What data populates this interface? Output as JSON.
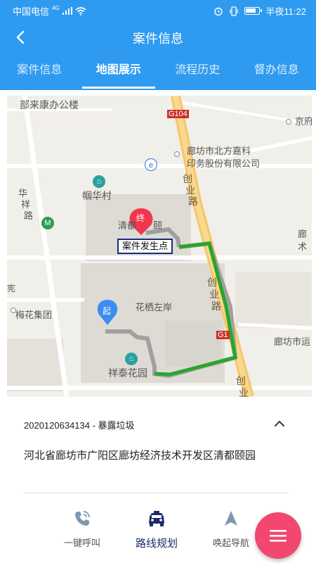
{
  "status_bar": {
    "carrier": "中国电信",
    "signal_label": "4G",
    "battery_level": 0.8,
    "time": "半夜11:22"
  },
  "app_bar": {
    "title": "案件信息",
    "back_icon": "arrow-left-icon"
  },
  "tabs": [
    {
      "label": "案件信息",
      "active": false
    },
    {
      "label": "地图展示",
      "active": true
    },
    {
      "label": "流程历史",
      "active": false
    },
    {
      "label": "督办信息",
      "active": false
    }
  ],
  "map": {
    "labels": {
      "office_building": "部来康办公楼",
      "road_g104_top": "G104",
      "jingfu": "京府",
      "company_line1": "廊坊市北方嘉科",
      "company_line2": "印务股份有限公司",
      "chuangye_road_1": "创",
      "chuangye_road_2": "业",
      "chuangye_road_3": "路",
      "huaxiang_1": "华",
      "huaxiang_2": "祥",
      "huaxiang_3": "路",
      "zhouhua_village": "帼华村",
      "qingdu": "清都",
      "yi": "颐",
      "case_marker": "案件发生点",
      "huaqi": "花栖左岸",
      "meihua": "梅花集团",
      "langfang_right": "廊坊市运",
      "xiangtai": "祥泰花园",
      "road_g1_mid": "G1",
      "chuangye_bottom_1": "创",
      "chuangye_bottom_2": "业",
      "lang_1": "廊",
      "lang_2": "术",
      "chuang_mid_1": "创",
      "chuang_mid_2": "业",
      "chuang_mid_3": "路",
      "edge_left": "宪"
    },
    "markers": {
      "start": "起",
      "end": "终"
    },
    "route_color": "#2aa52a"
  },
  "case": {
    "header": "2020120634134 - 暴露垃圾",
    "address": "河北省廊坊市广阳区廊坊经济技术开发区清都颐园"
  },
  "actions": [
    {
      "label": "一键呼叫",
      "icon": "phone-icon"
    },
    {
      "label": "路线规划",
      "icon": "car-icon"
    },
    {
      "label": "唤起导航",
      "icon": "navigation-arrow-icon"
    }
  ],
  "fab_icon": "menu-icon",
  "colors": {
    "primary": "#2f9bf0",
    "fab": "#f2476f",
    "route": "#2aa52a",
    "accent_text": "#1d2b6e"
  }
}
